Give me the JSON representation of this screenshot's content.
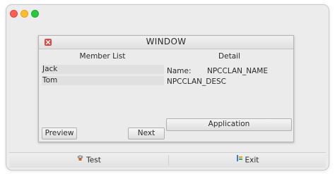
{
  "window": {
    "title": "WINDOW",
    "member_list": {
      "heading": "Member List",
      "items": [
        "Jack",
        "Tom"
      ]
    },
    "detail": {
      "heading": "Detail",
      "name_label": "Name:",
      "name_value": "NPCCLAN_NAME",
      "description": "NPCCLAN_DESC"
    },
    "buttons": {
      "preview": "Preview",
      "next": "Next",
      "application": "Application"
    }
  },
  "bottom_bar": {
    "test_label": "Test",
    "exit_label": "Exit"
  },
  "icons": {
    "close": "close-icon",
    "test": "test-icon",
    "exit": "exit-icon"
  }
}
